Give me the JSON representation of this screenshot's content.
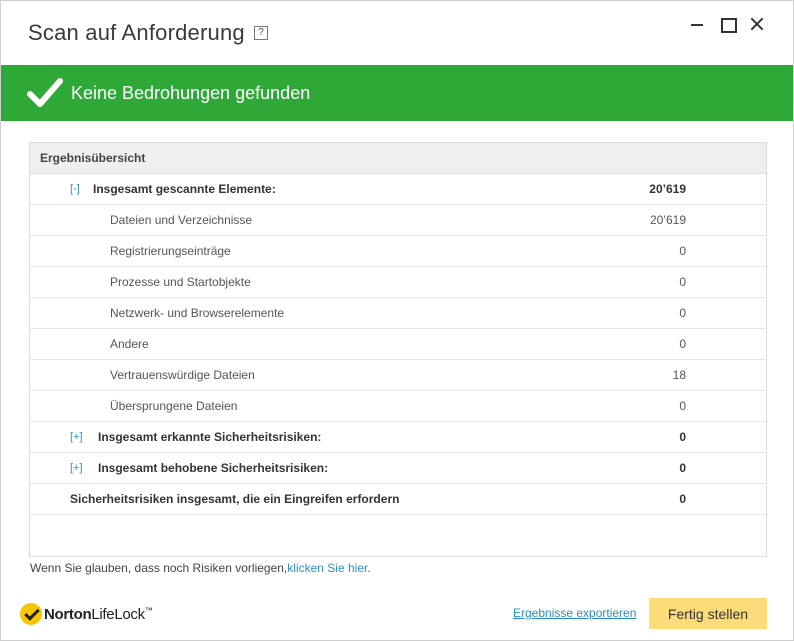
{
  "window": {
    "title": "Scan auf Anforderung",
    "help_label": "?"
  },
  "banner": {
    "status": "Keine Bedrohungen gefunden",
    "color": "#2ea836",
    "icon": "checkmark-icon"
  },
  "results": {
    "header": "Ergebnisübersicht",
    "total_scanned": {
      "toggle": "[-]",
      "label": "Insgesamt gescannte Elemente:",
      "value": "20’619"
    },
    "children": [
      {
        "label": "Dateien und Verzeichnisse",
        "value": "20’619"
      },
      {
        "label": "Registrierungseinträge",
        "value": "0"
      },
      {
        "label": "Prozesse und Startobjekte",
        "value": "0"
      },
      {
        "label": "Netzwerk- und Browserelemente",
        "value": "0"
      },
      {
        "label": "Andere",
        "value": "0"
      },
      {
        "label": "Vertrauenswürdige Dateien",
        "value": "18"
      },
      {
        "label": "Übersprungene Dateien",
        "value": "0"
      }
    ],
    "detected": {
      "toggle": "[+]",
      "label": "Insgesamt erkannte Sicherheitsrisiken:",
      "value": "0"
    },
    "resolved": {
      "toggle": "[+]",
      "label": "Insgesamt behobene Sicherheitsrisiken:",
      "value": "0"
    },
    "requiring_action": {
      "label": "Sicherheitsrisiken insgesamt, die ein Eingreifen erfordern",
      "value": "0"
    }
  },
  "note": {
    "text": "Wenn Sie glauben, dass noch Risiken vorliegen,",
    "link": "klicken Sie hier",
    "suffix": "."
  },
  "footer": {
    "brand_first": "Norton",
    "brand_second": "LifeLock",
    "brand_tm": "™",
    "export_link": "Ergebnisse exportieren",
    "done_button": "Fertig stellen",
    "accent": "#fcdc79"
  }
}
